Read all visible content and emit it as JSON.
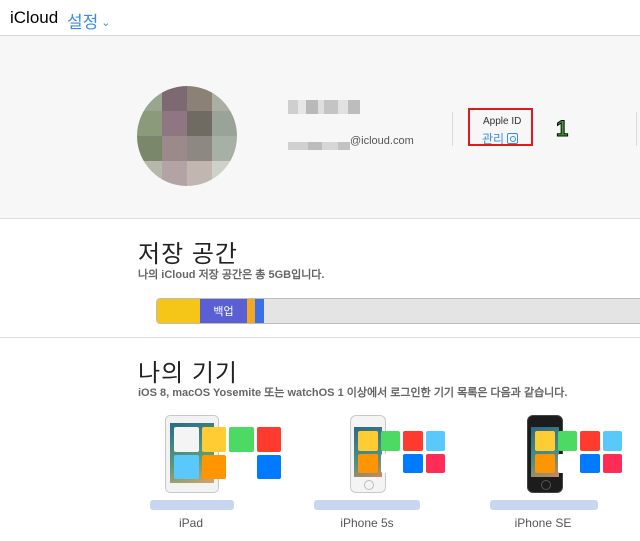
{
  "topbar": {
    "app_title": "iCloud",
    "settings_label": "설정",
    "chevron_icon": "chevron-down-icon"
  },
  "profile": {
    "email_domain": "@icloud.com",
    "apple_id": {
      "label": "Apple ID",
      "manage_label": "관리",
      "external_icon": "external-link-icon"
    },
    "annotation": "1"
  },
  "storage": {
    "title": "저장 공간",
    "subtitle": "나의 iCloud 저장 공간은 총 5GB입니다.",
    "segments": [
      {
        "label": "",
        "fraction": 0.085,
        "color": "#f5c518"
      },
      {
        "label": "백업",
        "fraction": 0.094,
        "color": "#5b5fd4"
      },
      {
        "label": "",
        "fraction": 0.016,
        "color": "#f5a623"
      },
      {
        "label": "",
        "fraction": 0.017,
        "color": "#3a6fe8"
      }
    ]
  },
  "devices": {
    "title": "나의 기기",
    "subtitle": "iOS 8, macOS Yosemite 또는 watchOS 1 이상에서 로그인한 기기 목록은 다음과 같습니다.",
    "items": [
      {
        "model": "iPad"
      },
      {
        "model": "iPhone 5s"
      },
      {
        "model": "iPhone SE"
      }
    ]
  },
  "colors": {
    "accent": "#3a8ce8",
    "highlight_border": "#e0191f",
    "annotation": "#3b9b2f"
  }
}
